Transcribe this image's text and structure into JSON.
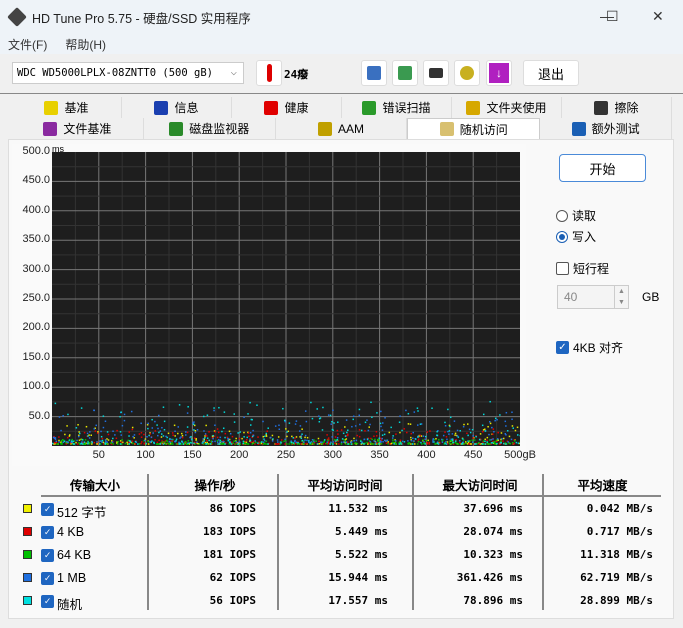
{
  "window": {
    "title": "HD Tune Pro 5.75 - 硬盘/SSD 实用程序",
    "minimize": "—",
    "maximize": "☐",
    "close": "✕"
  },
  "menu": [
    "文件(F)",
    "帮助(H)"
  ],
  "toolbar": {
    "drive": "WDC WD5000LPLX-08ZNTT0 (500 gB)",
    "temperature": "24癈",
    "exit_label": "退出"
  },
  "tabs_row1": [
    {
      "label": "基准",
      "icon": "exclamation-icon",
      "color": "#e8d000"
    },
    {
      "label": "信息",
      "icon": "info-icon",
      "color": "#1a3fb0"
    },
    {
      "label": "健康",
      "icon": "health-cross-icon",
      "color": "#e00000"
    },
    {
      "label": "错误扫描",
      "icon": "magnifier-icon",
      "color": "#2a9a2a"
    },
    {
      "label": "文件夹使用",
      "icon": "folder-icon",
      "color": "#d6a800"
    },
    {
      "label": "擦除",
      "icon": "trash-icon",
      "color": "#333333"
    }
  ],
  "tabs_row2": [
    {
      "label": "文件基准",
      "icon": "file-benchmark-icon",
      "color": "#8a2aa0"
    },
    {
      "label": "磁盘监视器",
      "icon": "monitor-chart-icon",
      "color": "#2a8a2a"
    },
    {
      "label": "AAM",
      "icon": "speaker-icon",
      "color": "#c0a000"
    },
    {
      "label": "随机访问",
      "icon": "random-access-icon",
      "color": "#d8c070",
      "active": true
    },
    {
      "label": "额外测试",
      "icon": "extra-tests-icon",
      "color": "#1a5fb4"
    }
  ],
  "controls": {
    "start_label": "开始",
    "read_label": "读取",
    "write_label": "写入",
    "mode": "write",
    "short_stroke_label": "短行程",
    "short_stroke_checked": false,
    "short_stroke_value": "40",
    "short_stroke_unit": "GB",
    "align_label": "4KB 对齐",
    "align_checked": true
  },
  "chart_data": {
    "type": "scatter",
    "ylabel": "ms",
    "xlabel": "gB",
    "y_ticks": [
      "500.0",
      "450.0",
      "400.0",
      "350.0",
      "300.0",
      "250.0",
      "200.0",
      "150.0",
      "100.0",
      "50.0"
    ],
    "x_ticks": [
      "50",
      "100",
      "150",
      "200",
      "250",
      "300",
      "350",
      "400",
      "450",
      "500gB"
    ],
    "xlim": [
      0,
      500
    ],
    "ylim": [
      0,
      500
    ],
    "grid": true,
    "series": [
      {
        "name": "512 字节",
        "color": "#e8e800",
        "typical_ms": [
          2,
          38
        ]
      },
      {
        "name": "4 KB",
        "color": "#e00000",
        "typical_ms": [
          2,
          28
        ]
      },
      {
        "name": "64 KB",
        "color": "#00c000",
        "typical_ms": [
          2,
          10
        ]
      },
      {
        "name": "1 MB",
        "color": "#2070e0",
        "typical_ms": [
          5,
          60
        ]
      },
      {
        "name": "随机",
        "color": "#00d8d8",
        "typical_ms": [
          2,
          75
        ]
      }
    ]
  },
  "results": {
    "headers": [
      "传输大小",
      "操作/秒",
      "平均访问时间",
      "最大访问时间",
      "平均速度"
    ],
    "rows": [
      {
        "label": "512 字节",
        "color": "#f0f000",
        "iops": "86 IOPS",
        "avg": "11.532 ms",
        "max": "37.696 ms",
        "speed": "0.042 MB/s"
      },
      {
        "label": "4 KB",
        "color": "#e00000",
        "iops": "183 IOPS",
        "avg": "5.449 ms",
        "max": "28.074 ms",
        "speed": "0.717 MB/s"
      },
      {
        "label": "64 KB",
        "color": "#00c000",
        "iops": "181 IOPS",
        "avg": "5.522 ms",
        "max": "10.323 ms",
        "speed": "11.318 MB/s"
      },
      {
        "label": "1 MB",
        "color": "#2070e0",
        "iops": "62 IOPS",
        "avg": "15.944 ms",
        "max": "361.426 ms",
        "speed": "62.719 MB/s"
      },
      {
        "label": "随机",
        "color": "#00e0e0",
        "iops": "56 IOPS",
        "avg": "17.557 ms",
        "max": "78.896 ms",
        "speed": "28.899 MB/s"
      }
    ]
  }
}
